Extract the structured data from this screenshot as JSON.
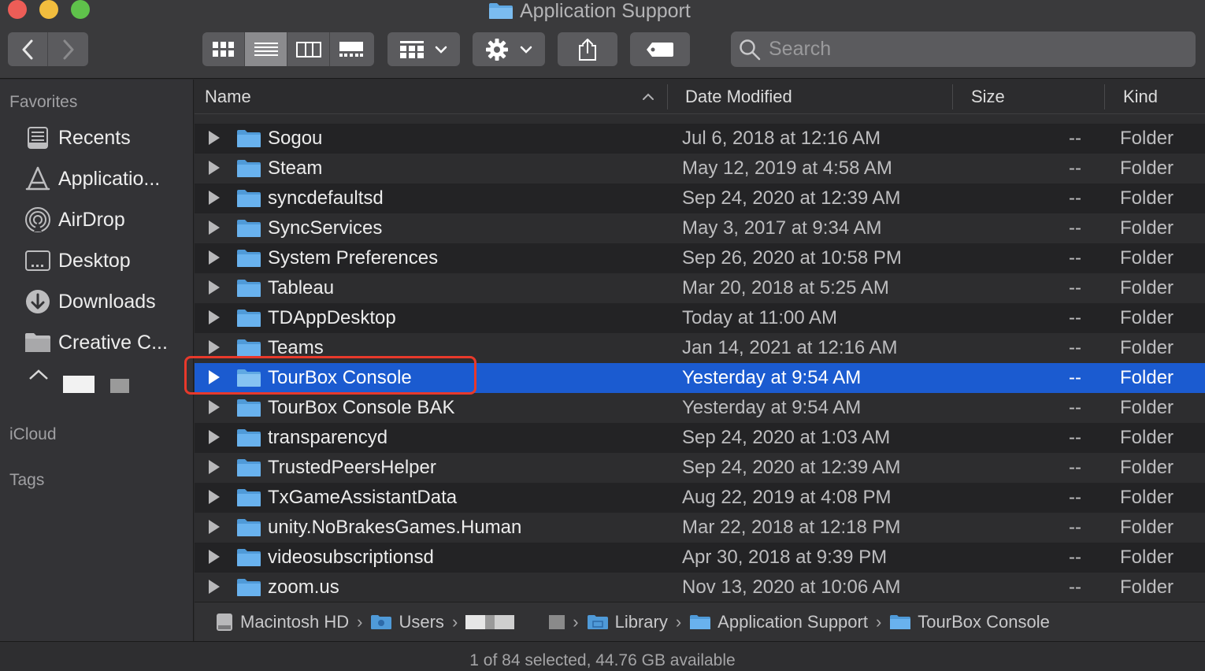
{
  "window": {
    "title": "Application Support",
    "search_placeholder": "Search"
  },
  "sidebar": {
    "favorites_header": "Favorites",
    "items": [
      {
        "label": "Recents",
        "icon": "recents-icon"
      },
      {
        "label": "Applicatio...",
        "icon": "applications-icon"
      },
      {
        "label": "AirDrop",
        "icon": "airdrop-icon"
      },
      {
        "label": "Desktop",
        "icon": "desktop-icon"
      },
      {
        "label": "Downloads",
        "icon": "downloads-icon"
      },
      {
        "label": "Creative C...",
        "icon": "folder-icon"
      }
    ],
    "icloud_header": "iCloud",
    "tags_header": "Tags"
  },
  "columns": {
    "name": "Name",
    "date": "Date Modified",
    "size": "Size",
    "kind": "Kind"
  },
  "files": [
    {
      "name": "Sogou",
      "date": "Jul 6, 2018 at 12:16 AM",
      "size": "--",
      "kind": "Folder"
    },
    {
      "name": "Steam",
      "date": "May 12, 2019 at 4:58 AM",
      "size": "--",
      "kind": "Folder"
    },
    {
      "name": "syncdefaultsd",
      "date": "Sep 24, 2020 at 12:39 AM",
      "size": "--",
      "kind": "Folder"
    },
    {
      "name": "SyncServices",
      "date": "May 3, 2017 at 9:34 AM",
      "size": "--",
      "kind": "Folder"
    },
    {
      "name": "System Preferences",
      "date": "Sep 26, 2020 at 10:58 PM",
      "size": "--",
      "kind": "Folder"
    },
    {
      "name": "Tableau",
      "date": "Mar 20, 2018 at 5:25 AM",
      "size": "--",
      "kind": "Folder"
    },
    {
      "name": "TDAppDesktop",
      "date": "Today at 11:00 AM",
      "size": "--",
      "kind": "Folder"
    },
    {
      "name": "Teams",
      "date": "Jan 14, 2021 at 12:16 AM",
      "size": "--",
      "kind": "Folder"
    },
    {
      "name": "TourBox Console",
      "date": "Yesterday at 9:54 AM",
      "size": "--",
      "kind": "Folder"
    },
    {
      "name": "TourBox Console BAK",
      "date": "Yesterday at 9:54 AM",
      "size": "--",
      "kind": "Folder"
    },
    {
      "name": "transparencyd",
      "date": "Sep 24, 2020 at 1:03 AM",
      "size": "--",
      "kind": "Folder"
    },
    {
      "name": "TrustedPeersHelper",
      "date": "Sep 24, 2020 at 12:39 AM",
      "size": "--",
      "kind": "Folder"
    },
    {
      "name": "TxGameAssistantData",
      "date": "Aug 22, 2019 at 4:08 PM",
      "size": "--",
      "kind": "Folder"
    },
    {
      "name": "unity.NoBrakesGames.Human",
      "date": "Mar 22, 2018 at 12:18 PM",
      "size": "--",
      "kind": "Folder"
    },
    {
      "name": "videosubscriptionsd",
      "date": "Apr 30, 2018 at 9:39 PM",
      "size": "--",
      "kind": "Folder"
    },
    {
      "name": "zoom.us",
      "date": "Nov 13, 2020 at 10:06 AM",
      "size": "--",
      "kind": "Folder"
    }
  ],
  "selected_file": "TourBox Console",
  "pathbar": {
    "drive": "Macintosh HD",
    "users": "Users",
    "library": "Library",
    "app_support": "Application Support",
    "current": "TourBox Console"
  },
  "status": "1 of 84 selected, 44.76 GB available",
  "colors": {
    "selection": "#1b5bd0",
    "highlight_box": "#e8392b",
    "folder": "#5fa8e3"
  }
}
